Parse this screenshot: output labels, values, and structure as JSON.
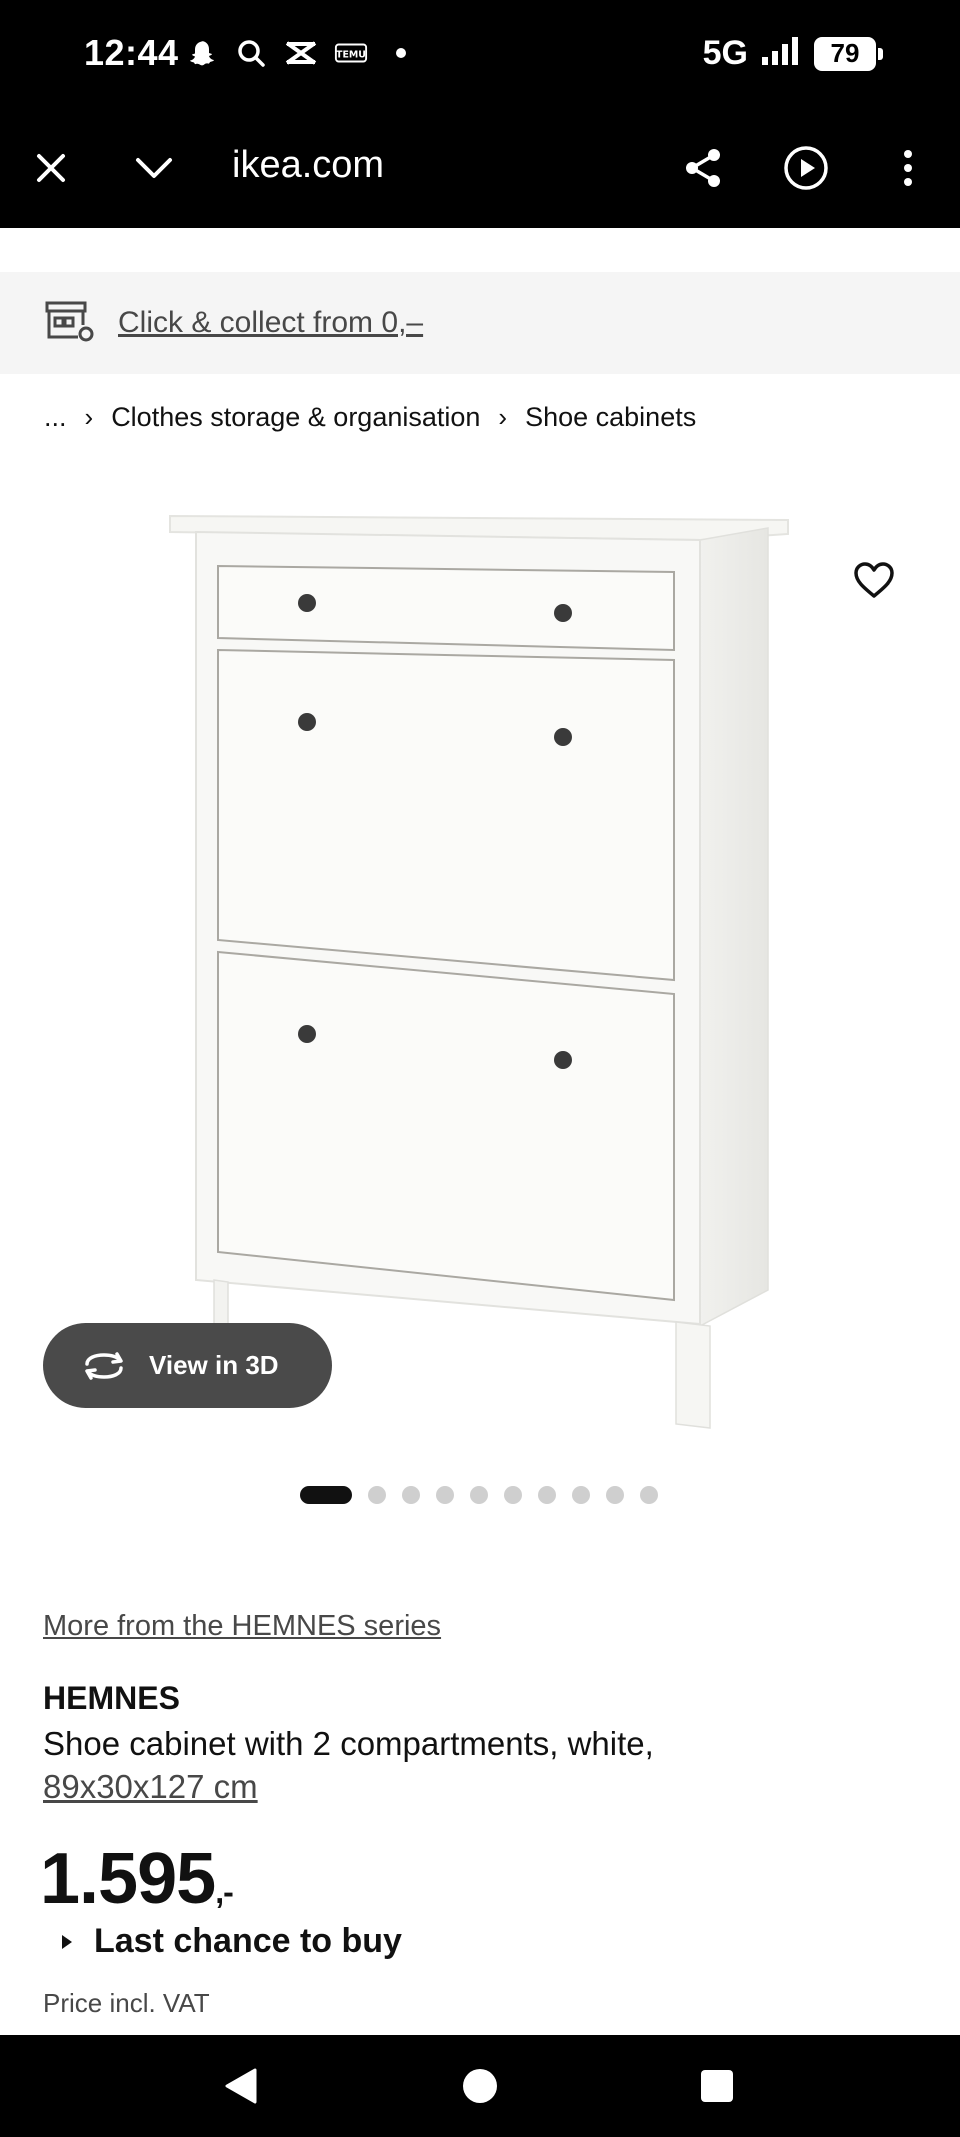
{
  "status_bar": {
    "time": "12:44",
    "network": "5G",
    "battery": "79",
    "icons": [
      "snapchat-icon",
      "search-icon",
      "temu-icon",
      "notification-dot-icon",
      "signal-icon",
      "battery-icon"
    ]
  },
  "browser": {
    "url": "ikea.com",
    "icons": [
      "close-icon",
      "chevron-down-icon",
      "share-icon",
      "play-icon",
      "more-vert-icon"
    ]
  },
  "collect_banner": {
    "text": "Click & collect from 0,–",
    "icon": "store-icon"
  },
  "breadcrumb": {
    "ellipsis": "...",
    "sep": "›",
    "items": [
      "Clothes storage & organisation",
      "Shoe cabinets"
    ]
  },
  "product_image": {
    "view_3d_label": "View in 3D",
    "heart_icon": "heart-icon",
    "carousel_count": 10,
    "carousel_active": 1
  },
  "product": {
    "series_link": "More from the HEMNES series",
    "brand": "HEMNES",
    "description": "Shoe cabinet with 2 compartments, white,",
    "dimensions": "89x30x127 cm",
    "price": "1.595",
    "price_suffix": ",-",
    "status": "Last chance to buy",
    "vat_note": "Price incl. VAT"
  },
  "nav_bar": {
    "icons": [
      "back-icon",
      "home-icon",
      "recents-icon"
    ]
  }
}
